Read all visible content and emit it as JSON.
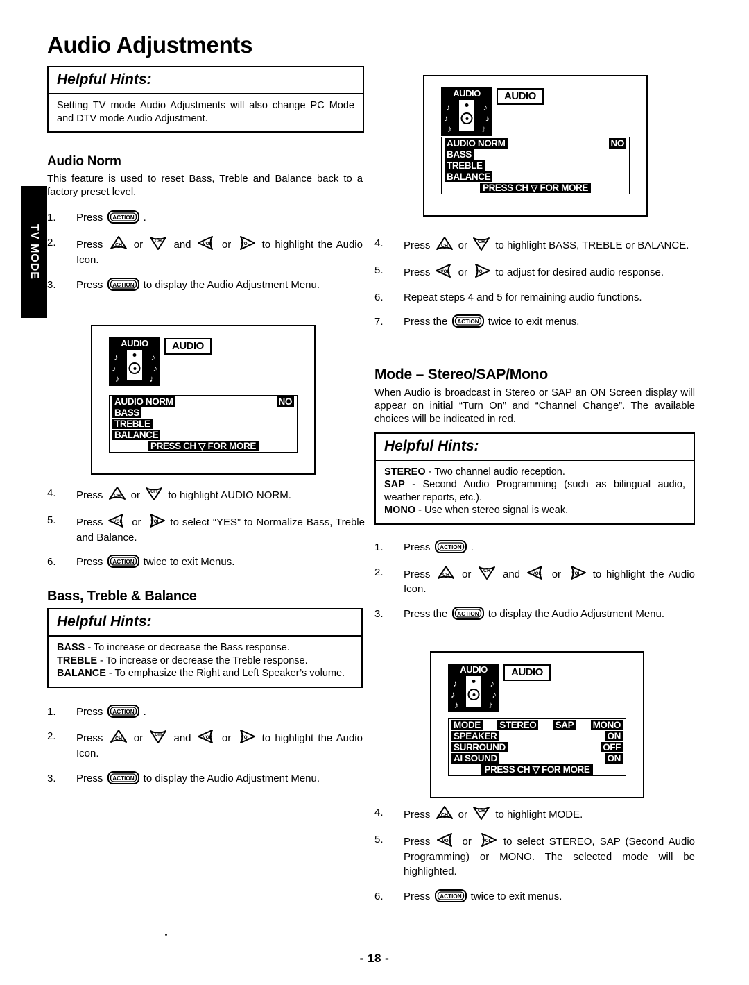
{
  "page": {
    "title": "Audio Adjustments",
    "side_tab": "TV MODE",
    "page_number": "- 18 -"
  },
  "hints_label": "Helpful Hints:",
  "top_hint": {
    "label": "Helpful Hints:",
    "text": "Setting TV mode Audio Adjustments will also change PC Mode and DTV mode Audio Adjustment."
  },
  "audio_norm": {
    "heading": "Audio Norm",
    "intro": "This feature is used to reset Bass, Treble and Balance back to a factory preset level.",
    "steps": [
      {
        "num": "1.",
        "parts": [
          {
            "t": "text",
            "v": "Press "
          },
          {
            "t": "key",
            "v": "action-key"
          },
          {
            "t": "text",
            "v": " ."
          }
        ]
      },
      {
        "num": "2.",
        "parts": [
          {
            "t": "text",
            "v": "Press "
          },
          {
            "t": "key",
            "v": "ch-up-key"
          },
          {
            "t": "text",
            "v": " or "
          },
          {
            "t": "key",
            "v": "ch-down-key"
          },
          {
            "t": "text",
            "v": " and "
          },
          {
            "t": "key",
            "v": "vol-left-key"
          },
          {
            "t": "text",
            "v": " or "
          },
          {
            "t": "key",
            "v": "vol-right-key"
          },
          {
            "t": "text",
            "v": " to highlight the Audio Icon."
          }
        ]
      },
      {
        "num": "3.",
        "parts": [
          {
            "t": "text",
            "v": "Press "
          },
          {
            "t": "key",
            "v": "action-key"
          },
          {
            "t": "text",
            "v": " to display the Audio Adjustment Menu."
          }
        ]
      }
    ],
    "steps2": [
      {
        "num": "4.",
        "parts": [
          {
            "t": "text",
            "v": "Press "
          },
          {
            "t": "key",
            "v": "ch-up-key"
          },
          {
            "t": "text",
            "v": " or "
          },
          {
            "t": "key",
            "v": "ch-down-key"
          },
          {
            "t": "text",
            "v": " to highlight AUDIO NORM."
          }
        ]
      },
      {
        "num": "5.",
        "parts": [
          {
            "t": "text",
            "v": "Press "
          },
          {
            "t": "key",
            "v": "vol-left-key"
          },
          {
            "t": "text",
            "v": " or "
          },
          {
            "t": "key",
            "v": "vol-right-key"
          },
          {
            "t": "text",
            "v": " to select “YES” to Normalize Bass, Treble and Balance."
          }
        ]
      },
      {
        "num": "6.",
        "parts": [
          {
            "t": "text",
            "v": "Press "
          },
          {
            "t": "key",
            "v": "action-key"
          },
          {
            "t": "text",
            "v": " twice to exit Menus."
          }
        ]
      }
    ]
  },
  "bass_treble_balance": {
    "heading": "Bass, Treble & Balance",
    "hint_label": "Helpful Hints:",
    "hint_lines": [
      {
        "term": "BASS",
        "dash": " - ",
        "text": "To increase or decrease the Bass response."
      },
      {
        "term": "TREBLE",
        "dash": " - ",
        "text": "To increase or decrease the Treble response."
      },
      {
        "term": "BALANCE",
        "dash": " - ",
        "text": "To emphasize the Right and Left Speaker’s volume."
      }
    ],
    "steps": [
      {
        "num": "1.",
        "parts": [
          {
            "t": "text",
            "v": "Press "
          },
          {
            "t": "key",
            "v": "action-key"
          },
          {
            "t": "text",
            "v": " ."
          }
        ]
      },
      {
        "num": "2.",
        "parts": [
          {
            "t": "text",
            "v": "Press "
          },
          {
            "t": "key",
            "v": "ch-up-key"
          },
          {
            "t": "text",
            "v": " or "
          },
          {
            "t": "key",
            "v": "ch-down-key"
          },
          {
            "t": "text",
            "v": " and "
          },
          {
            "t": "key",
            "v": "vol-left-key"
          },
          {
            "t": "text",
            "v": " or "
          },
          {
            "t": "key",
            "v": "vol-right-key"
          },
          {
            "t": "text",
            "v": " to highlight the Audio Icon."
          }
        ]
      },
      {
        "num": "3.",
        "parts": [
          {
            "t": "text",
            "v": "Press "
          },
          {
            "t": "key",
            "v": "action-key"
          },
          {
            "t": "text",
            "v": " to display the Audio Adjustment Menu."
          }
        ]
      }
    ],
    "steps_right": [
      {
        "num": "4.",
        "parts": [
          {
            "t": "text",
            "v": "Press "
          },
          {
            "t": "key",
            "v": "ch-up-key"
          },
          {
            "t": "text",
            "v": " or "
          },
          {
            "t": "key",
            "v": "ch-down-key"
          },
          {
            "t": "text",
            "v": " to highlight BASS, TREBLE or BALANCE."
          }
        ]
      },
      {
        "num": "5.",
        "parts": [
          {
            "t": "text",
            "v": "Press "
          },
          {
            "t": "key",
            "v": "vol-left-key"
          },
          {
            "t": "text",
            "v": " or "
          },
          {
            "t": "key",
            "v": "vol-right-key"
          },
          {
            "t": "text",
            "v": " to adjust for desired audio response."
          }
        ]
      },
      {
        "num": "6.",
        "parts": [
          {
            "t": "text",
            "v": "Repeat steps 4 and 5 for remaining audio functions."
          }
        ]
      },
      {
        "num": "7.",
        "parts": [
          {
            "t": "text",
            "v": "Press the "
          },
          {
            "t": "key",
            "v": "action-key"
          },
          {
            "t": "text",
            "v": " twice to exit menus."
          }
        ]
      }
    ]
  },
  "mode_section": {
    "heading": "Mode – Stereo/SAP/Mono",
    "intro": "When Audio is broadcast in Stereo or SAP an ON Screen display will appear on initial “Turn On” and “Channel Change”. The available choices will be indicated in red.",
    "hint_label": "Helpful Hints:",
    "hint_lines": [
      {
        "term": "STEREO",
        "dash": " - ",
        "text": "Two channel audio reception."
      },
      {
        "term": "SAP",
        "dash": " - ",
        "text": "Second Audio Programming (such as bilingual audio, weather reports, etc.)."
      },
      {
        "term": "MONO",
        "dash": " - ",
        "text": "Use when stereo signal is weak."
      }
    ],
    "steps": [
      {
        "num": "1.",
        "parts": [
          {
            "t": "text",
            "v": "Press "
          },
          {
            "t": "key",
            "v": "action-key"
          },
          {
            "t": "text",
            "v": " ."
          }
        ]
      },
      {
        "num": "2.",
        "parts": [
          {
            "t": "text",
            "v": "Press "
          },
          {
            "t": "key",
            "v": "ch-up-key"
          },
          {
            "t": "text",
            "v": " or "
          },
          {
            "t": "key",
            "v": "ch-down-key"
          },
          {
            "t": "text",
            "v": " and "
          },
          {
            "t": "key",
            "v": "vol-left-key"
          },
          {
            "t": "text",
            "v": " or "
          },
          {
            "t": "key",
            "v": "vol-right-key"
          },
          {
            "t": "text",
            "v": " to highlight the Audio Icon."
          }
        ]
      },
      {
        "num": "3.",
        "parts": [
          {
            "t": "text",
            "v": "Press the "
          },
          {
            "t": "key",
            "v": "action-key"
          },
          {
            "t": "text",
            "v": " to display the Audio Adjustment Menu."
          }
        ]
      }
    ],
    "steps2": [
      {
        "num": "4.",
        "parts": [
          {
            "t": "text",
            "v": "Press "
          },
          {
            "t": "key",
            "v": "ch-up-key"
          },
          {
            "t": "text",
            "v": " or "
          },
          {
            "t": "key",
            "v": "ch-down-key"
          },
          {
            "t": "text",
            "v": " to highlight MODE."
          }
        ]
      },
      {
        "num": "5.",
        "parts": [
          {
            "t": "text",
            "v": "Press "
          },
          {
            "t": "key",
            "v": "vol-left-key"
          },
          {
            "t": "text",
            "v": " or "
          },
          {
            "t": "key",
            "v": "vol-right-key"
          },
          {
            "t": "text",
            "v": " to select STEREO, SAP (Second Audio Programming) or MONO. The selected mode will be highlighted."
          }
        ]
      },
      {
        "num": "6.",
        "parts": [
          {
            "t": "text",
            "v": "Press "
          },
          {
            "t": "key",
            "v": "action-key"
          },
          {
            "t": "text",
            "v": " twice to exit menus."
          }
        ]
      }
    ]
  },
  "osd_audio_left": {
    "icon_label": "AUDIO",
    "tag_label": "AUDIO",
    "rows": [
      {
        "label": "AUDIO NORM",
        "value": "NO"
      },
      {
        "label": "BASS",
        "value": ""
      },
      {
        "label": "TREBLE",
        "value": ""
      },
      {
        "label": "BALANCE",
        "value": ""
      }
    ],
    "footer": "PRESS CH ▽ FOR MORE"
  },
  "osd_audio_right": {
    "icon_label": "AUDIO",
    "tag_label": "AUDIO",
    "rows": [
      {
        "label": "AUDIO NORM",
        "value": "NO"
      },
      {
        "label": "BASS",
        "value": ""
      },
      {
        "label": "TREBLE",
        "value": ""
      },
      {
        "label": "BALANCE",
        "value": ""
      }
    ],
    "footer": "PRESS CH ▽ FOR MORE"
  },
  "osd_mode": {
    "icon_label": "AUDIO",
    "tag_label": "AUDIO",
    "mode_row": {
      "label": "MODE",
      "options": [
        "STEREO",
        "SAP",
        "MONO"
      ]
    },
    "rows": [
      {
        "label": "SPEAKER",
        "value": "ON"
      },
      {
        "label": "SURROUND",
        "value": "OFF"
      },
      {
        "label": "AI SOUND",
        "value": "ON"
      }
    ],
    "footer": "PRESS CH ▽ FOR MORE"
  },
  "keys": {
    "action": "ACTION",
    "ch": "CH",
    "vol": "VOL"
  }
}
